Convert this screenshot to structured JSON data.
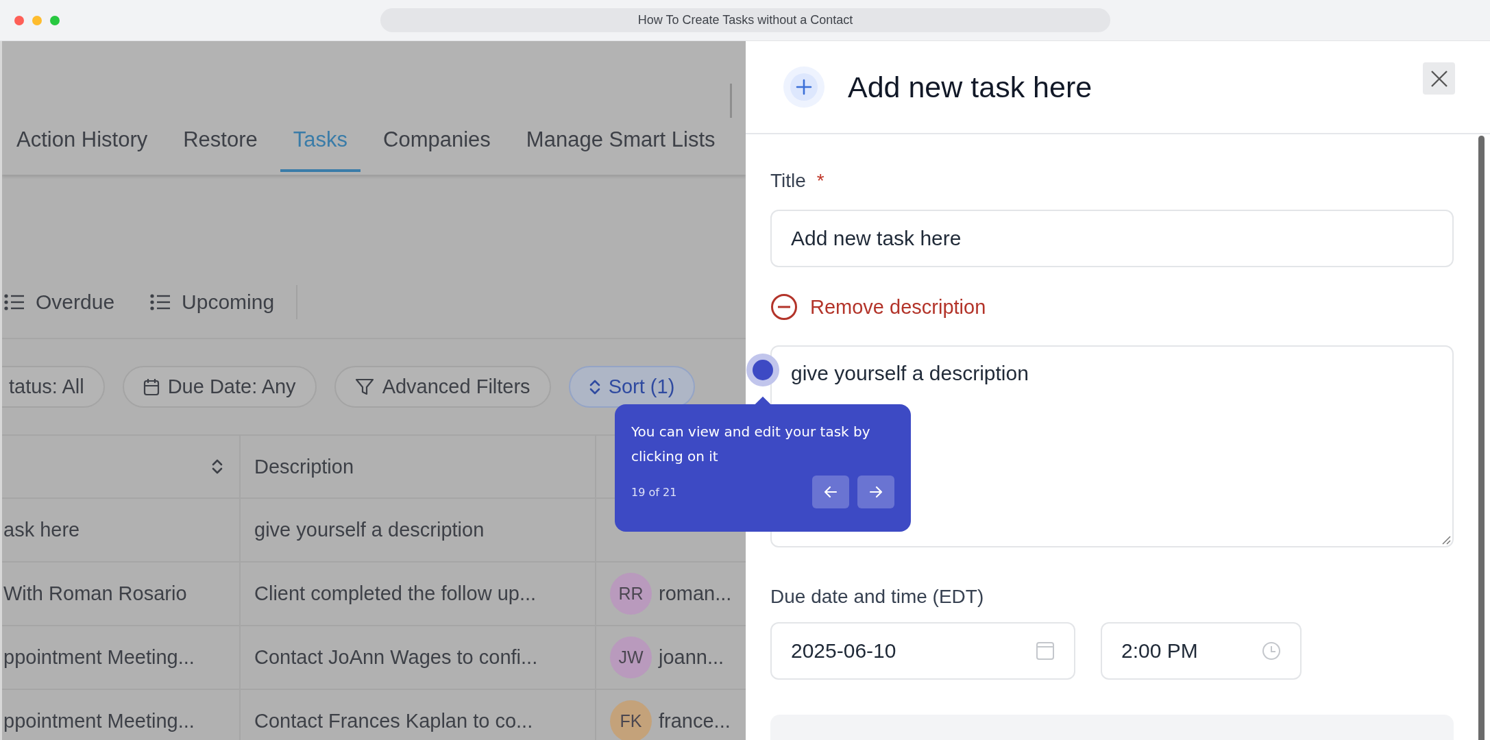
{
  "window": {
    "title": "How To Create Tasks without a Contact"
  },
  "tabs": [
    {
      "label": "Action History",
      "selected": false
    },
    {
      "label": "Restore",
      "selected": false
    },
    {
      "label": "Tasks",
      "selected": true
    },
    {
      "label": "Companies",
      "selected": false
    },
    {
      "label": "Manage Smart Lists",
      "selected": false
    }
  ],
  "views": [
    {
      "label": "Overdue"
    },
    {
      "label": "Upcoming"
    }
  ],
  "filters": [
    {
      "kind": "status",
      "label": "tatus: All",
      "selected": false
    },
    {
      "kind": "date",
      "label": "Due Date: Any",
      "selected": false
    },
    {
      "kind": "advanced",
      "label": "Advanced Filters",
      "selected": false
    },
    {
      "kind": "sort",
      "label": "Sort (1)",
      "selected": true
    }
  ],
  "table": {
    "columns": [
      {
        "kind": "sort"
      },
      {
        "kind": "text",
        "label": "Description"
      },
      {
        "kind": "blank"
      }
    ],
    "rows": [
      {
        "column_1": "ask here",
        "description": "give yourself a description"
      },
      {
        "column_1": "With Roman Rosario",
        "description": "Client completed the follow up...",
        "assignee": {
          "initials": "RR",
          "name": "roman...",
          "color": "#b99abd"
        }
      },
      {
        "column_1": "ppointment Meeting...",
        "description": "Contact JoAnn Wages to confi...",
        "assignee": {
          "initials": "JW",
          "name": "joann...",
          "color": "#b99abd"
        }
      },
      {
        "column_1": "ppointment Meeting...",
        "description": "Contact Frances Kaplan to co...",
        "assignee": {
          "initials": "FK",
          "name": "france...",
          "color": "#c4a27a"
        }
      }
    ]
  },
  "tour": {
    "text": "You can view and edit your task by clicking on it",
    "progress": "19 of 21"
  },
  "panel": {
    "title": "Add new task here",
    "title_label": "Title",
    "required_mark": "*",
    "title_value": "Add new task here",
    "remove_description": "Remove description",
    "description_value": "give yourself a description",
    "due_label": "Due date and time (EDT)",
    "date_value": "2025-06-10",
    "time_value": "2:00 PM"
  }
}
